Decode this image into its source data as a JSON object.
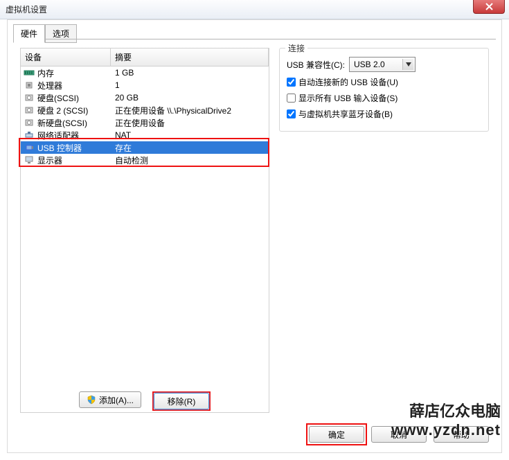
{
  "window": {
    "title": "虚拟机设置"
  },
  "tabs": {
    "hardware": "硬件",
    "options": "选项"
  },
  "list": {
    "header_device": "设备",
    "header_summary": "摘要",
    "rows": [
      {
        "device": "内存",
        "summary": "1 GB",
        "icon": "memory"
      },
      {
        "device": "处理器",
        "summary": "1",
        "icon": "cpu"
      },
      {
        "device": "硬盘(SCSI)",
        "summary": "20 GB",
        "icon": "hdd"
      },
      {
        "device": "硬盘 2 (SCSI)",
        "summary": "正在使用设备 \\\\.\\PhysicalDrive2",
        "icon": "hdd"
      },
      {
        "device": "新硬盘(SCSI)",
        "summary": "正在使用设备",
        "icon": "hdd"
      },
      {
        "device": "网络适配器",
        "summary": "NAT",
        "icon": "net"
      },
      {
        "device": "USB 控制器",
        "summary": "存在",
        "icon": "usb",
        "selected": true
      },
      {
        "device": "显示器",
        "summary": "自动检测",
        "icon": "display"
      }
    ]
  },
  "buttons": {
    "add": "添加(A)...",
    "remove": "移除(R)",
    "ok": "确定",
    "cancel": "取消",
    "help": "帮助"
  },
  "connection": {
    "group_title": "连接",
    "compat_label": "USB 兼容性(C):",
    "compat_value": "USB 2.0",
    "auto_connect": "自动连接新的 USB 设备(U)",
    "show_all": "显示所有 USB 输入设备(S)",
    "share_bt": "与虚拟机共享蓝牙设备(B)",
    "auto_connect_checked": true,
    "show_all_checked": false,
    "share_bt_checked": true
  },
  "watermark": {
    "line1": "薛店亿众电脑",
    "line2": "www.yzdn.net"
  }
}
